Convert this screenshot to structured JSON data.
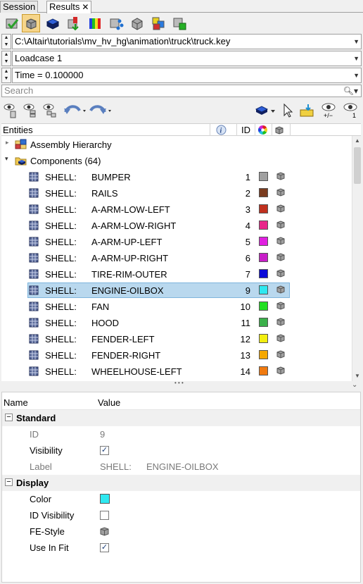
{
  "tabs": [
    {
      "label": "Session",
      "active": false
    },
    {
      "label": "Results",
      "active": true,
      "close": "✕"
    }
  ],
  "toolbar_icons": [
    "results-browser-icon",
    "component-view-icon",
    "blue-cube-icon",
    "red-load-icon",
    "contour-icon",
    "tracing-icon",
    "grey-cube-icon",
    "color-cubes-icon",
    "green-add-icon"
  ],
  "file_path": "C:\\Altair\\tutorials\\mv_hv_hg\\animation\\truck\\truck.key",
  "loadcase": "Loadcase 1",
  "time": "Time = 0.100000",
  "search": {
    "placeholder": "Search"
  },
  "entities_header": {
    "entities": "Entities",
    "id": "ID"
  },
  "tree": {
    "assembly": "Assembly Hierarchy",
    "components": "Components (64)",
    "rows": [
      {
        "type": "SHELL:",
        "name": "BUMPER",
        "id": "1",
        "color": "#a0a0a0"
      },
      {
        "type": "SHELL:",
        "name": "RAILS",
        "id": "2",
        "color": "#7a3b1e"
      },
      {
        "type": "SHELL:",
        "name": "A-ARM-LOW-LEFT",
        "id": "3",
        "color": "#c0301e"
      },
      {
        "type": "SHELL:",
        "name": "A-ARM-LOW-RIGHT",
        "id": "4",
        "color": "#e8268a"
      },
      {
        "type": "SHELL:",
        "name": "A-ARM-UP-LEFT",
        "id": "5",
        "color": "#e020e0"
      },
      {
        "type": "SHELL:",
        "name": "A-ARM-UP-RIGHT",
        "id": "6",
        "color": "#c81ec8"
      },
      {
        "type": "SHELL:",
        "name": "TIRE-RIM-OUTER",
        "id": "7",
        "color": "#0a0ad8"
      },
      {
        "type": "SHELL:",
        "name": "ENGINE-OILBOX",
        "id": "9",
        "color": "#2ee8f0",
        "selected": true
      },
      {
        "type": "SHELL:",
        "name": "FAN",
        "id": "10",
        "color": "#22e022"
      },
      {
        "type": "SHELL:",
        "name": "HOOD",
        "id": "11",
        "color": "#3bb04a"
      },
      {
        "type": "SHELL:",
        "name": "FENDER-LEFT",
        "id": "12",
        "color": "#f2ee10"
      },
      {
        "type": "SHELL:",
        "name": "FENDER-RIGHT",
        "id": "13",
        "color": "#f5a800"
      },
      {
        "type": "SHELL:",
        "name": "WHEELHOUSE-LEFT",
        "id": "14",
        "color": "#f07a10"
      }
    ]
  },
  "splitter_dots": "• • •",
  "props": {
    "col_name": "Name",
    "col_value": "Value",
    "standard": "Standard",
    "display": "Display",
    "id_label": "ID",
    "id_value": "9",
    "visibility_label": "Visibility",
    "label_label": "Label",
    "label_type": "SHELL:",
    "label_name": "ENGINE-OILBOX",
    "color_label": "Color",
    "color_value": "#2ee8f0",
    "id_visibility_label": "ID Visibility",
    "fe_style_label": "FE-Style",
    "use_in_fit_label": "Use In Fit",
    "checkmark": "✓"
  }
}
